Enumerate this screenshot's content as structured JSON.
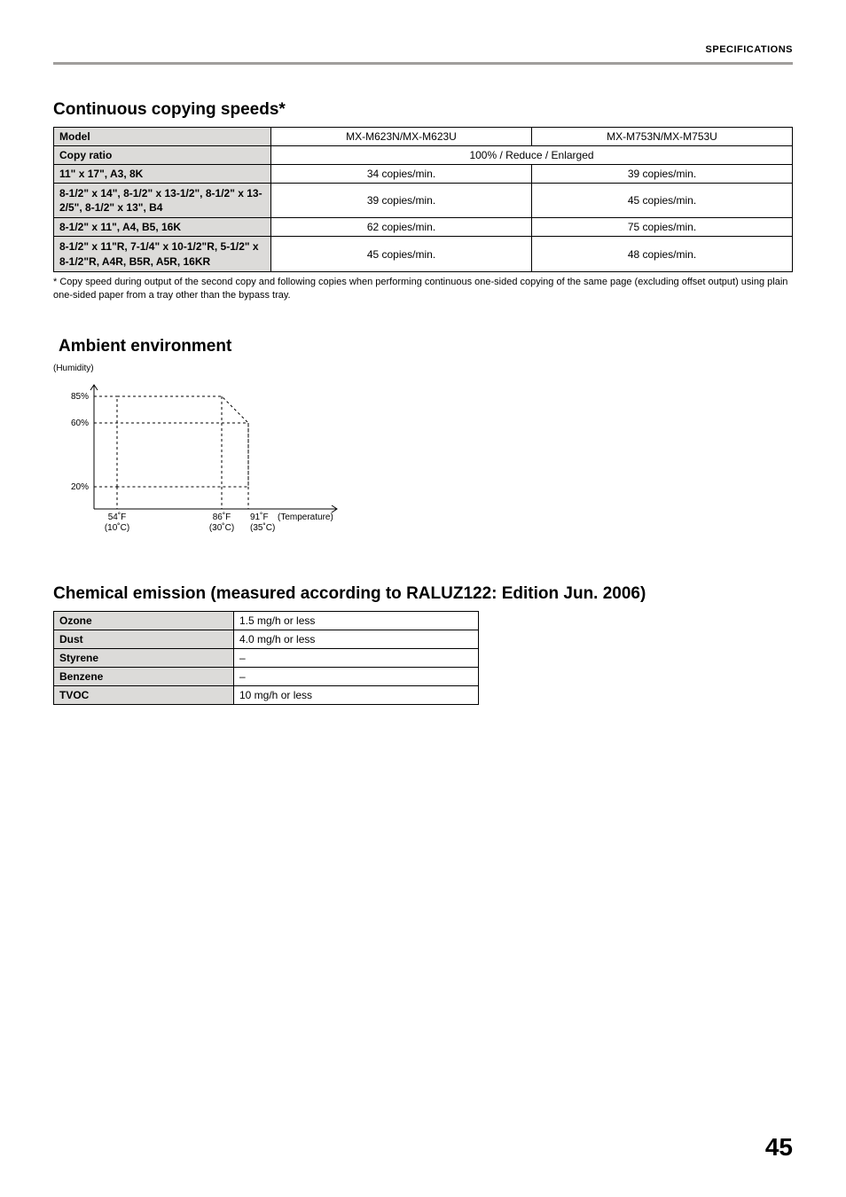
{
  "header": {
    "section": "SPECIFICATIONS"
  },
  "sections": {
    "speeds": {
      "title": "Continuous copying speeds*",
      "model_label": "Model",
      "copy_ratio_label": "Copy ratio",
      "models": {
        "a": "MX-M623N/MX-M623U",
        "b": "MX-M753N/MX-M753U"
      },
      "copy_ratio_value": "100% / Reduce / Enlarged",
      "rows": [
        {
          "label": "11\" x 17\", A3, 8K",
          "a": "34 copies/min.",
          "b": "39 copies/min."
        },
        {
          "label": "8-1/2\" x 14\", 8-1/2\" x 13-1/2\", 8-1/2\" x 13-2/5\",  8-1/2\" x 13\", B4",
          "a": "39 copies/min.",
          "b": "45 copies/min."
        },
        {
          "label": "8-1/2\" x 11\", A4, B5, 16K",
          "a": "62 copies/min.",
          "b": "75 copies/min."
        },
        {
          "label": "8-1/2\" x 11\"R, 7-1/4\" x 10-1/2\"R, 5-1/2\" x 8-1/2\"R, A4R, B5R, A5R, 16KR",
          "a": "45 copies/min.",
          "b": "48 copies/min."
        }
      ],
      "footnote": "*  Copy speed during output of the second copy and following copies when performing continuous one-sided copying of the same page (excluding offset output) using plain one-sided paper from a tray other than the bypass tray."
    },
    "ambient": {
      "title": "Ambient environment",
      "humidity_label": "(Humidity)",
      "y_ticks": {
        "p85": "85%",
        "p60": "60%",
        "p20": "20%"
      },
      "x_ticks": {
        "t54f": "54˚F",
        "t54c": "(10˚C)",
        "t86f": "86˚F",
        "t86c": "(30˚C)",
        "t91f": "91˚F",
        "t91c": "(35˚C)",
        "temp_label": "(Temperature)"
      }
    },
    "chemical": {
      "title": "Chemical emission (measured according to RALUZ122: Edition Jun. 2006)",
      "rows": [
        {
          "label": "Ozone",
          "value": "1.5 mg/h or less"
        },
        {
          "label": "Dust",
          "value": "4.0 mg/h or less"
        },
        {
          "label": "Styrene",
          "value": "–"
        },
        {
          "label": "Benzene",
          "value": "–"
        },
        {
          "label": "TVOC",
          "value": "10 mg/h or less"
        }
      ]
    }
  },
  "chart_data": {
    "type": "area",
    "title": "Ambient environment",
    "xlabel": "(Temperature)",
    "ylabel": "(Humidity)",
    "x_unit_primary": "˚F",
    "x_unit_secondary": "˚C",
    "ylim": [
      0,
      100
    ],
    "y_ticks": [
      20,
      60,
      85
    ],
    "x_ticks_f": [
      54,
      86,
      91
    ],
    "x_ticks_c": [
      10,
      30,
      35
    ],
    "region_vertices": [
      {
        "tempF": 54,
        "humidity": 20
      },
      {
        "tempF": 54,
        "humidity": 85
      },
      {
        "tempF": 86,
        "humidity": 85
      },
      {
        "tempF": 91,
        "humidity": 60
      },
      {
        "tempF": 91,
        "humidity": 20
      }
    ],
    "annotations": []
  },
  "page_number": "45"
}
